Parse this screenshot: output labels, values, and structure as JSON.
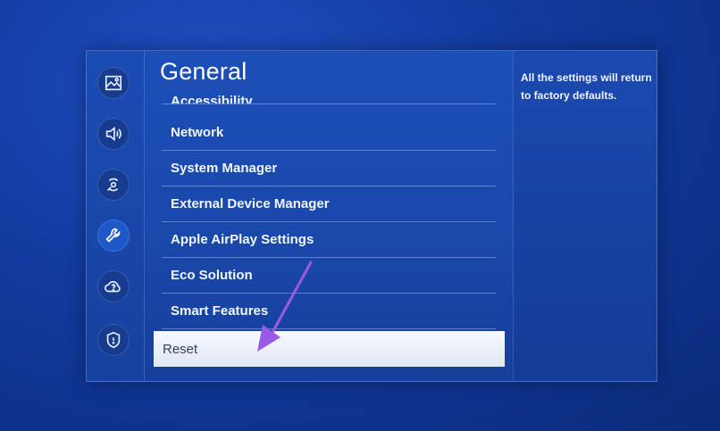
{
  "settings": {
    "section_title": "General",
    "menu_items": [
      {
        "label": "Accessibility"
      },
      {
        "label": "Network"
      },
      {
        "label": "System Manager"
      },
      {
        "label": "External Device Manager"
      },
      {
        "label": "Apple AirPlay Settings"
      },
      {
        "label": "Eco Solution"
      },
      {
        "label": "Smart Features"
      },
      {
        "label": "Reset"
      }
    ],
    "selected_item": "Reset",
    "description": "All the settings will return to factory defaults."
  },
  "sidebar": {
    "icons": [
      "picture-icon",
      "sound-icon",
      "broadcasting-icon",
      "general-wrench-icon",
      "support-icon",
      "privacy-shield-icon"
    ],
    "active": "general-wrench-icon"
  },
  "colors": {
    "panel_blue": "#1a47aa",
    "selection": "#eef2fa",
    "arrow": "#9b59e8"
  }
}
